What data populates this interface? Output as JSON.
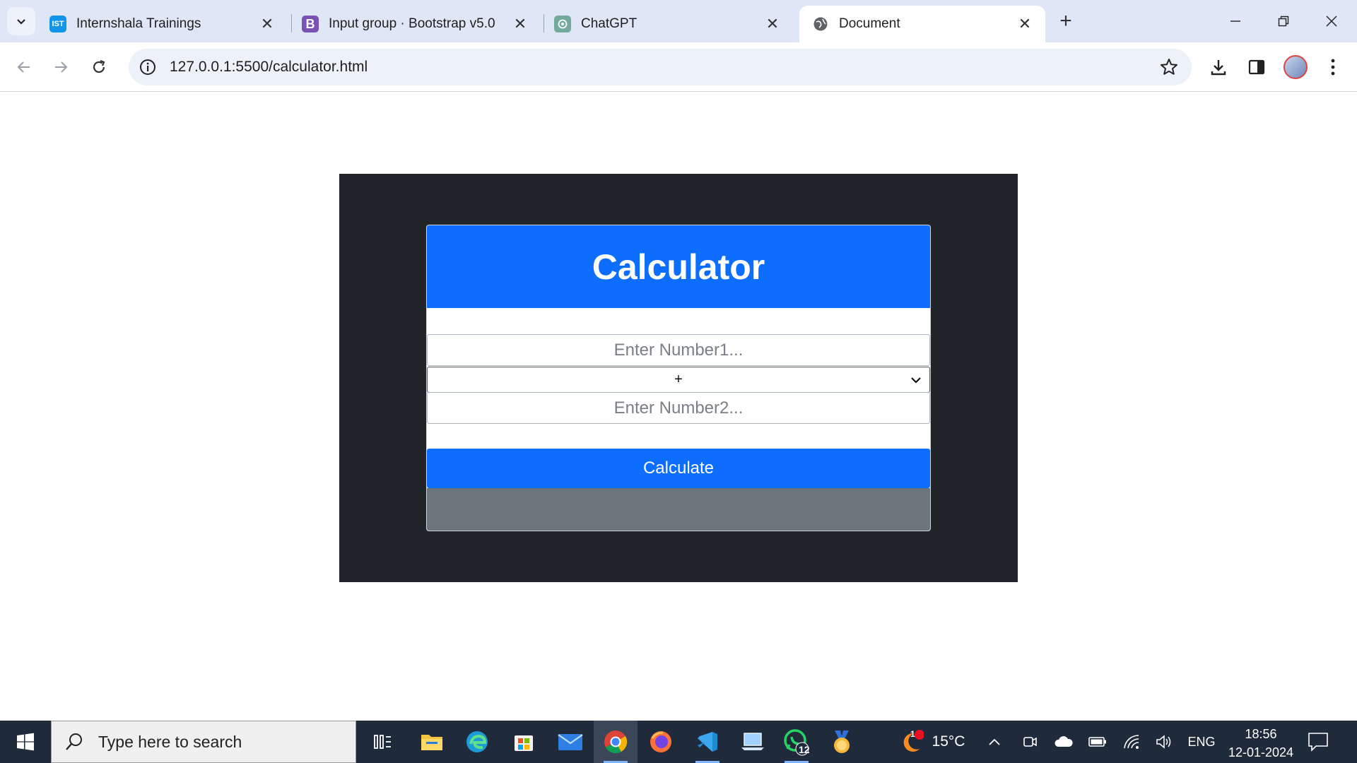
{
  "browser": {
    "tabs": [
      {
        "title": "Internshala Trainings",
        "favicon": "internshala-favicon",
        "favicon_text": "IST",
        "favicon_color": "#1295e6",
        "active": false
      },
      {
        "title": "Input group · Bootstrap v5.0",
        "favicon": "bootstrap-favicon",
        "favicon_text": "B",
        "favicon_color": "#7952b3",
        "active": false
      },
      {
        "title": "ChatGPT",
        "favicon": "chatgpt-favicon",
        "favicon_text": "",
        "favicon_color": "#74aa9c",
        "active": false
      },
      {
        "title": "Document",
        "favicon": "globe-favicon",
        "favicon_text": "",
        "favicon_color": "#5f6368",
        "active": true
      }
    ],
    "url": "127.0.0.1:5500/calculator.html"
  },
  "calculator": {
    "title": "Calculator",
    "number1_placeholder": "Enter Number1...",
    "operator_value": "+",
    "number2_placeholder": "Enter Number2...",
    "calculate_label": "Calculate",
    "result": ""
  },
  "taskbar": {
    "search_placeholder": "Type here to search",
    "weather_temp": "15°C",
    "weather_badge": "1",
    "whatsapp_badge": "12",
    "language": "ENG",
    "time": "18:56",
    "date": "12-01-2024"
  },
  "colors": {
    "primary": "#0d6efd",
    "dark_panel": "#212529",
    "result_bg": "#6c757d",
    "tab_strip": "#dfe7f7",
    "taskbar": "#1f2a3a"
  }
}
